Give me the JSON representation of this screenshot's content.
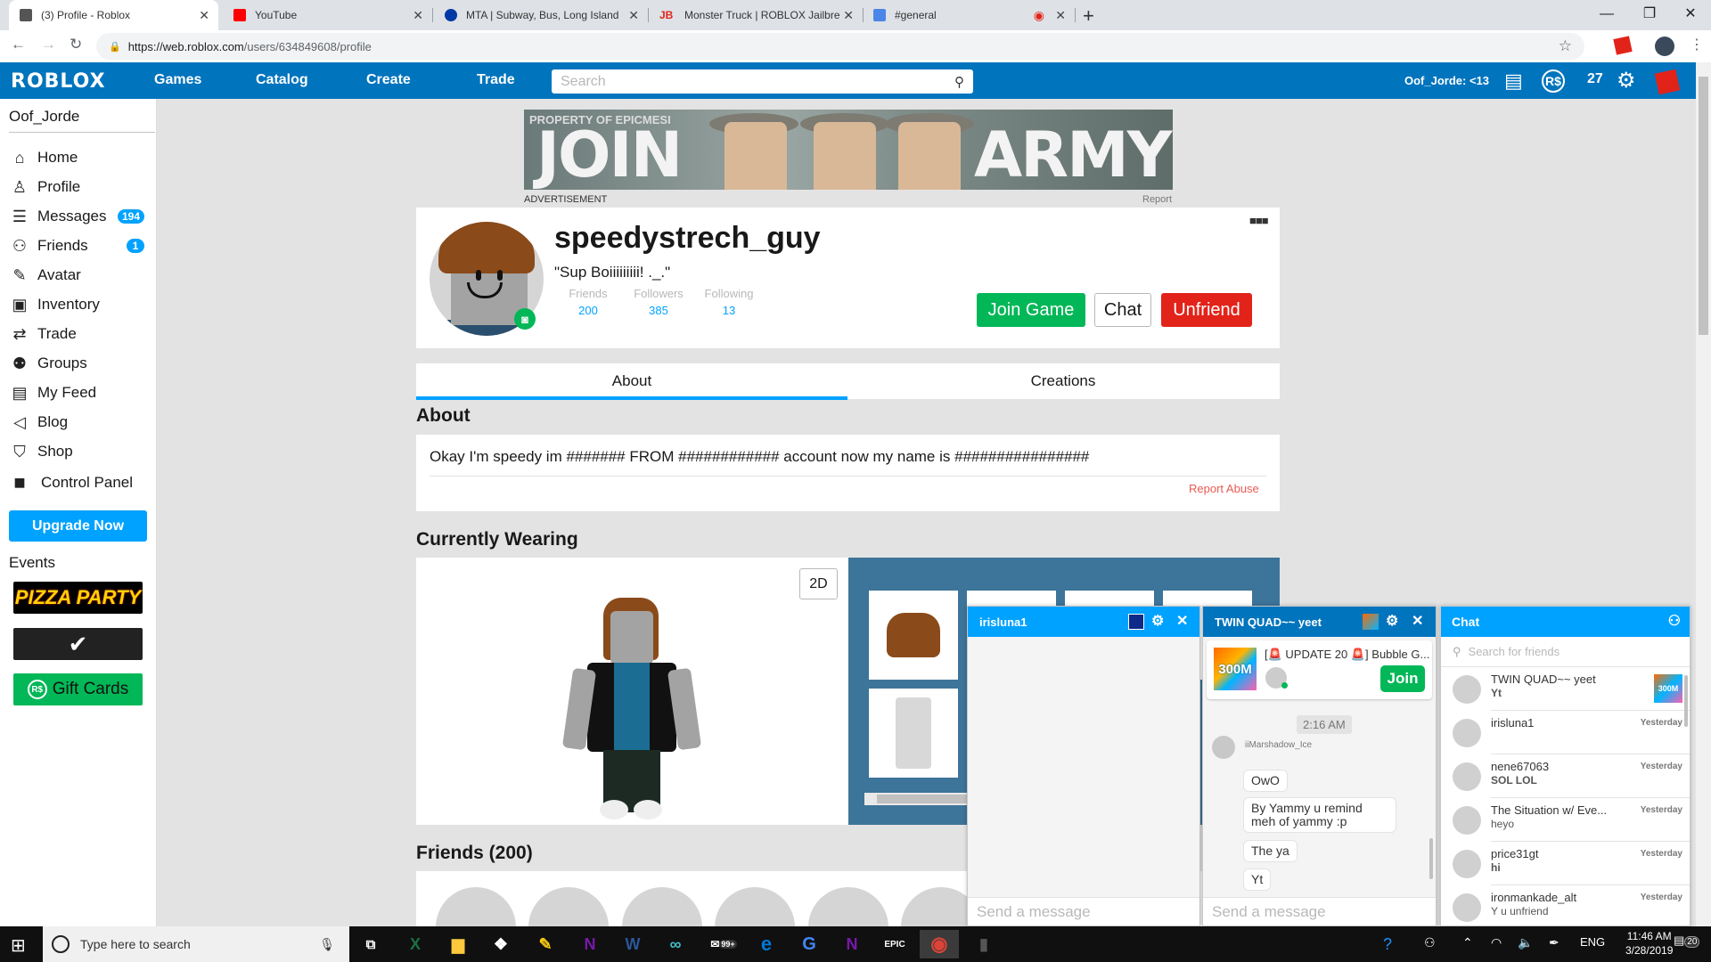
{
  "browser": {
    "tabs": [
      {
        "title": "(3) Profile - Roblox",
        "icon": "roblox-favicon",
        "color": "#555555",
        "active": true
      },
      {
        "title": "YouTube",
        "icon": "youtube-favicon",
        "color": "#ff0000"
      },
      {
        "title": "MTA | Subway, Bus, Long Island R",
        "icon": "mta-favicon",
        "color": "#0039a6"
      },
      {
        "title": "Monster Truck | ROBLOX Jailbreak",
        "icon": "jailbreak-favicon",
        "color": "#e2231a"
      },
      {
        "title": "#general",
        "icon": "discord-favicon",
        "color": "#4a86e8",
        "recording": true
      }
    ],
    "new_tab": "+",
    "url_host": "https://web.roblox.com",
    "url_path": "/users/634849608/profile"
  },
  "header": {
    "logo": "ROBLOX",
    "nav": [
      "Games",
      "Catalog",
      "Create",
      "Trade"
    ],
    "search_placeholder": "Search",
    "user": "Oof_Jorde: <13",
    "robux": "27"
  },
  "sidebar": {
    "username": "Oof_Jorde",
    "items": [
      {
        "label": "Home",
        "icon": "home-icon",
        "glyph": "⌂"
      },
      {
        "label": "Profile",
        "icon": "profile-icon",
        "glyph": "♙"
      },
      {
        "label": "Messages",
        "icon": "messages-icon",
        "glyph": "☰",
        "badge": "194"
      },
      {
        "label": "Friends",
        "icon": "friends-icon",
        "glyph": "⚇",
        "badge": "1"
      },
      {
        "label": "Avatar",
        "icon": "avatar-icon",
        "glyph": "✎"
      },
      {
        "label": "Inventory",
        "icon": "inventory-icon",
        "glyph": "▣"
      },
      {
        "label": "Trade",
        "icon": "trade-icon",
        "glyph": "⇄"
      },
      {
        "label": "Groups",
        "icon": "groups-icon",
        "glyph": "⚉"
      },
      {
        "label": "My Feed",
        "icon": "feed-icon",
        "glyph": "▤"
      },
      {
        "label": "Blog",
        "icon": "blog-icon",
        "glyph": "◁"
      },
      {
        "label": "Shop",
        "icon": "shop-icon",
        "glyph": "⛉"
      },
      {
        "label": "Control Panel",
        "icon": "control-panel-icon",
        "glyph": "■"
      }
    ],
    "upgrade": "Upgrade Now",
    "events_title": "Events",
    "events": [
      "PIZZA PARTY",
      "✔",
      "Gift Cards"
    ]
  },
  "ad": {
    "watermark": "PROPERTY OF EPICMESI",
    "headline_left": "JOIN",
    "headline_right": "ARMY",
    "label": "ADVERTISEMENT",
    "report": "Report"
  },
  "profile": {
    "name": "speedystrech_guy",
    "status": "\"Sup Boiiiiiiiii! ._.\"",
    "stats": [
      {
        "label": "Friends",
        "value": "200"
      },
      {
        "label": "Followers",
        "value": "385"
      },
      {
        "label": "Following",
        "value": "13"
      }
    ],
    "buttons": {
      "join": "Join Game",
      "chat": "Chat",
      "unfriend": "Unfriend"
    },
    "more": "■■■"
  },
  "tabs": [
    "About",
    "Creations"
  ],
  "about": {
    "title": "About",
    "text": "Okay I'm speedy im ####### FROM ############ account now my name is ################",
    "report_abuse": "Report Abuse"
  },
  "wearing": {
    "title": "Currently Wearing",
    "toggle": "2D"
  },
  "friends": {
    "title": "Friends (200)"
  },
  "chat_windows": [
    {
      "title": "irisluna1",
      "input_placeholder": "Send a message"
    },
    {
      "title": "TWIN QUAD~~ yeet",
      "game": {
        "title": "[🚨 UPDATE 20 🚨] Bubble G...",
        "thumb_text": "300M",
        "join": "Join"
      },
      "time": "2:16 AM",
      "sender": "iiMarshadow_Ice",
      "messages": [
        "OwO",
        "By Yammy u remind meh of yammy :p",
        "The ya",
        "Yt"
      ],
      "input_placeholder": "Send a message"
    }
  ],
  "chat_list": {
    "title": "Chat",
    "search_placeholder": "Search for friends",
    "items": [
      {
        "name": "TWIN QUAD~~ yeet",
        "message": "Yt",
        "time": "",
        "bold": true,
        "game_thumb": "300M"
      },
      {
        "name": "irisluna1",
        "message": "",
        "time": "Yesterday"
      },
      {
        "name": "nene67063",
        "message": "SOL LOL",
        "time": "Yesterday",
        "bold": true
      },
      {
        "name": "The Situation w/ Eve...",
        "message": "heyo",
        "time": "Yesterday"
      },
      {
        "name": "price31gt",
        "message": "hi",
        "time": "Yesterday",
        "bold": true
      },
      {
        "name": "ironmankade_alt",
        "message": "Y u unfriend",
        "time": "Yesterday"
      }
    ]
  },
  "taskbar": {
    "search_placeholder": "Type here to search",
    "apps": [
      "task-view",
      "excel",
      "file-explorer",
      "dropbox",
      "paint",
      "onenote",
      "word",
      "infinity",
      "mail-99+",
      "edge",
      "google",
      "onenote-2",
      "epic-games",
      "chrome",
      "mouse-app"
    ],
    "mail_badge": "99+",
    "language": "ENG",
    "time": "11:46 AM",
    "date": "3/28/2019",
    "notifications": "20"
  },
  "colors": {
    "roblox_blue": "#0074bd",
    "accent": "#00a2ff",
    "green": "#02b757",
    "red": "#e2231a"
  }
}
